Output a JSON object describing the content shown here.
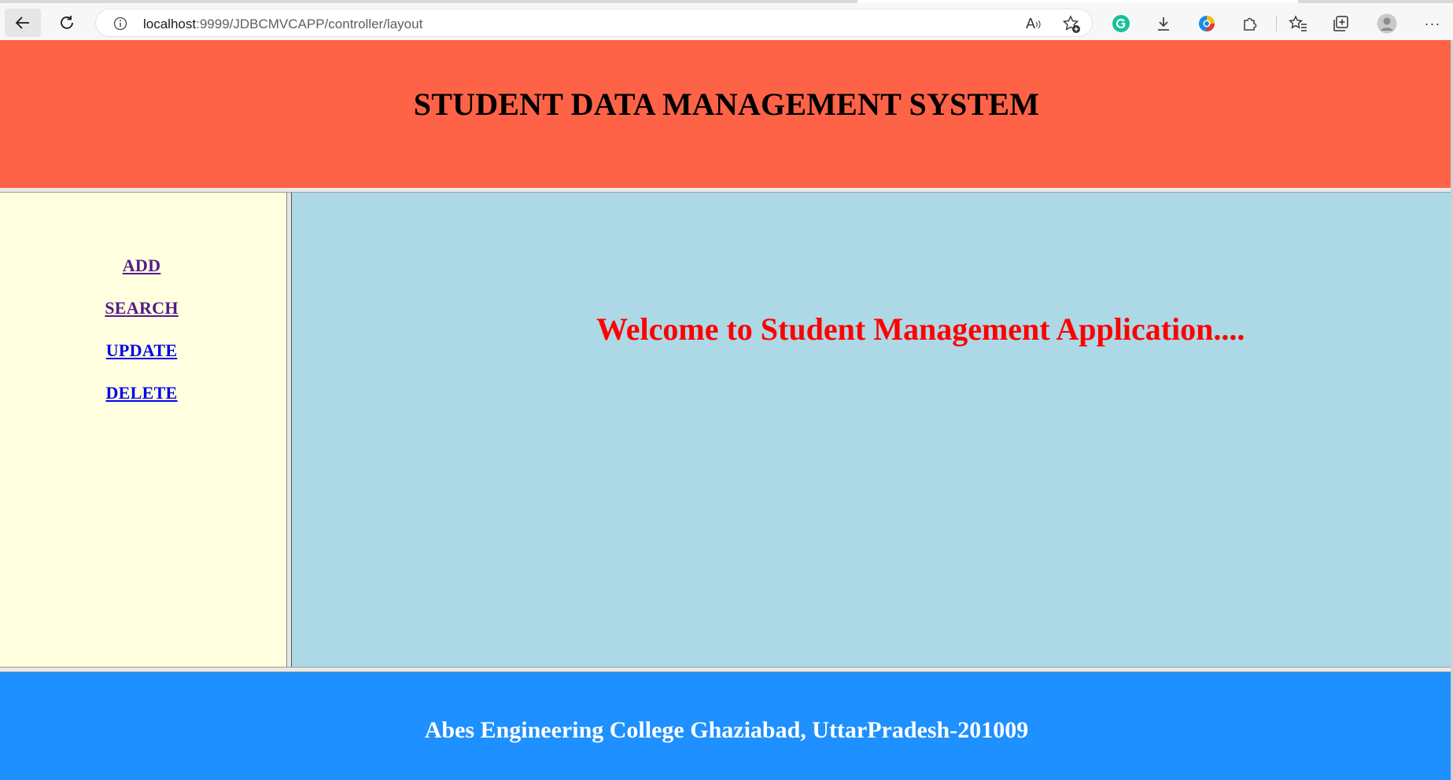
{
  "browser": {
    "url_host": "localhost",
    "url_rest": ":9999/JDBCMVCAPP/controller/layout",
    "read_aloud_label": "A",
    "more_label": "···"
  },
  "header": {
    "title": "STUDENT DATA MANAGEMENT SYSTEM",
    "bg_color": "#ff6347"
  },
  "sidebar": {
    "bg_color": "#ffffe0",
    "items": [
      {
        "label": "ADD",
        "state": "visited"
      },
      {
        "label": "SEARCH",
        "state": "visited"
      },
      {
        "label": "UPDATE",
        "state": "link"
      },
      {
        "label": "DELETE",
        "state": "link"
      }
    ]
  },
  "main": {
    "bg_color": "#add8e6",
    "welcome": "Welcome to Student Management Application...."
  },
  "footer": {
    "text": "Abes Engineering College Ghaziabad, UttarPradesh-201009",
    "bg_color": "#1e90ff"
  }
}
